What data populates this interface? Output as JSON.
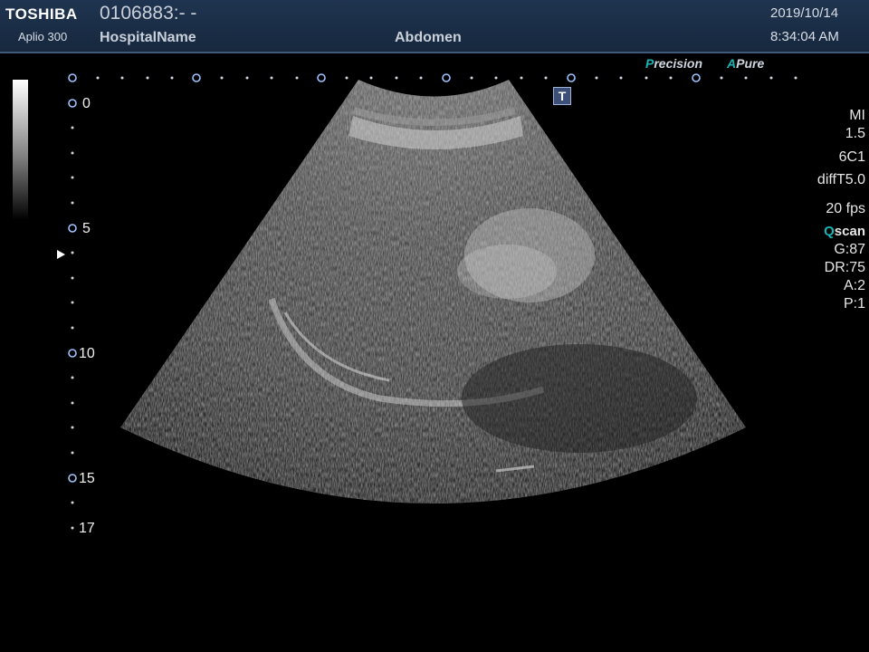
{
  "header": {
    "brand": "TOSHIBA",
    "model": "Aplio 300",
    "patient_id": "0106883:- -",
    "hospital": "HospitalName",
    "exam": "Abdomen",
    "date": "2019/10/14",
    "time": "8:34:04 AM"
  },
  "logos": {
    "precision_letter": "P",
    "precision_rest": "recision",
    "pure_letter": "A",
    "pure_rest": "Pure"
  },
  "t_marker": "T",
  "depth_scale": {
    "labels": [
      "0",
      "5",
      "10",
      "15",
      "17"
    ],
    "unit_hint": "cm"
  },
  "params": {
    "mi_label": "MI",
    "mi_value": "1.5",
    "probe": "6C1",
    "mode": "diffT5.0",
    "frame_rate": "20 fps",
    "qscan_q": "Q",
    "qscan_rest": "scan",
    "gain": "G:87",
    "dynamic_range": "DR:75",
    "a": "A:2",
    "p": "P:1"
  },
  "colors": {
    "header_bg": "#1f3450",
    "accent_teal": "#19b5b5",
    "marker_blue": "#3b4f79"
  }
}
